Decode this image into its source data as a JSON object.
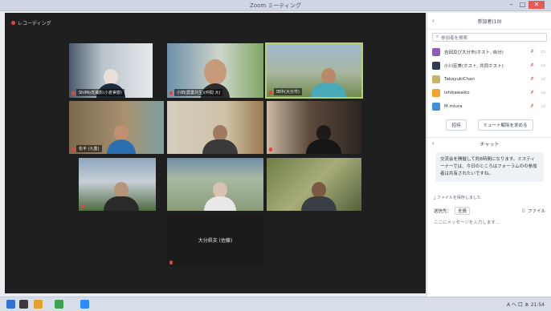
{
  "window": {
    "title": "Zoom ミーティング"
  },
  "video": {
    "recording_label": "レコーディング",
    "tiles": [
      {
        "name": "ShiMo氏撮影(小倉実樹)",
        "muted": true
      },
      {
        "name": "小田(農業共生)(仲間 大)",
        "muted": true
      },
      {
        "name": "田中(大分市)",
        "muted": true,
        "active": true
      },
      {
        "name": "松平 (九重)",
        "muted": true
      },
      {
        "name": "",
        "muted": false
      },
      {
        "name": "",
        "muted": true
      },
      {
        "name": "",
        "muted": true
      },
      {
        "name": "",
        "muted": false
      },
      {
        "name": "",
        "muted": false
      },
      {
        "name": "大分県支 (佐藤)",
        "muted": true,
        "avatar": true
      }
    ]
  },
  "participants_panel": {
    "title": "参加者(10)",
    "search_placeholder": "参加者を検索",
    "rows": [
      {
        "name": "吉田及び大分市(ホスト, 自分)",
        "color": "#8e5bb8"
      },
      {
        "name": "小川宏美(ホスト, 共同ホスト)",
        "color": "#2f3b52"
      },
      {
        "name": "TakayukiChan",
        "color": "#c7b46a"
      },
      {
        "name": "ishikawaiko",
        "color": "#f0a330"
      },
      {
        "name": "M.miura",
        "color": "#3f8fd6"
      }
    ],
    "invite_button": "招待",
    "unmute_all_button": "ミュート解除を求める"
  },
  "chat": {
    "title": "チャット",
    "message": "交流会を開催して約8時間になります。ミスティーナーでは、今日のところはフォーラムのの参加者は共有されたいですね。",
    "file_info": "ファイルを保存しました",
    "send_to_label": "送信先：",
    "send_to_value": "全員",
    "file_button": "ファイル",
    "input_placeholder": "ここにメッセージを入力します..."
  },
  "taskbar": {
    "tray_text": "A へ 口 ぁ 21:54"
  }
}
